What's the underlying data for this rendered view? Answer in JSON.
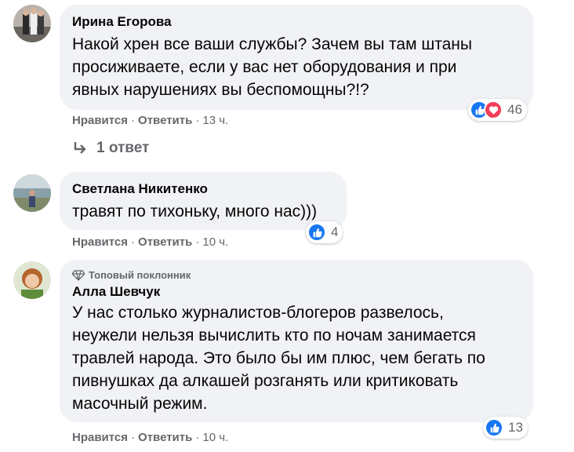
{
  "comments": [
    {
      "author": "Ирина Егорова",
      "lines": [
        "Накой хрен все ваши службы? Зачем вы там штаны",
        "просиживаете, если у вас нет оборудования и при",
        "явных нарушениях вы беспомощны?!?"
      ],
      "like_label": "Нравится",
      "reply_label": "Ответить",
      "time": "13 ч.",
      "reaction_count": "46",
      "reactions": [
        "like",
        "love"
      ]
    },
    {
      "author": "Светлана Никитенко",
      "lines": [
        "травят по тихоньку, много нас)))"
      ],
      "like_label": "Нравится",
      "reply_label": "Ответить",
      "time": "10 ч.",
      "reaction_count": "4",
      "reactions": [
        "like"
      ]
    },
    {
      "badge": "Топовый поклонник",
      "author": "Алла Шевчук",
      "lines": [
        "У нас столько журналистов-блогеров развелось,",
        "неужели нельзя вычислить кто по ночам занимается",
        "травлей народа. Это было бы им плюс, чем бегать по",
        "пивнушках да алкашей розганять или критиковать",
        "масочный режим."
      ],
      "like_label": "Нравится",
      "reply_label": "Ответить",
      "time": "10 ч.",
      "reaction_count": "13",
      "reactions": [
        "like"
      ]
    }
  ],
  "replies_link": "1 ответ",
  "separator": "·",
  "colors": {
    "bubble": "#f0f2f5",
    "meta_text": "#65676b",
    "like_blue": "#1877f2",
    "love_red": "#f33e58"
  }
}
